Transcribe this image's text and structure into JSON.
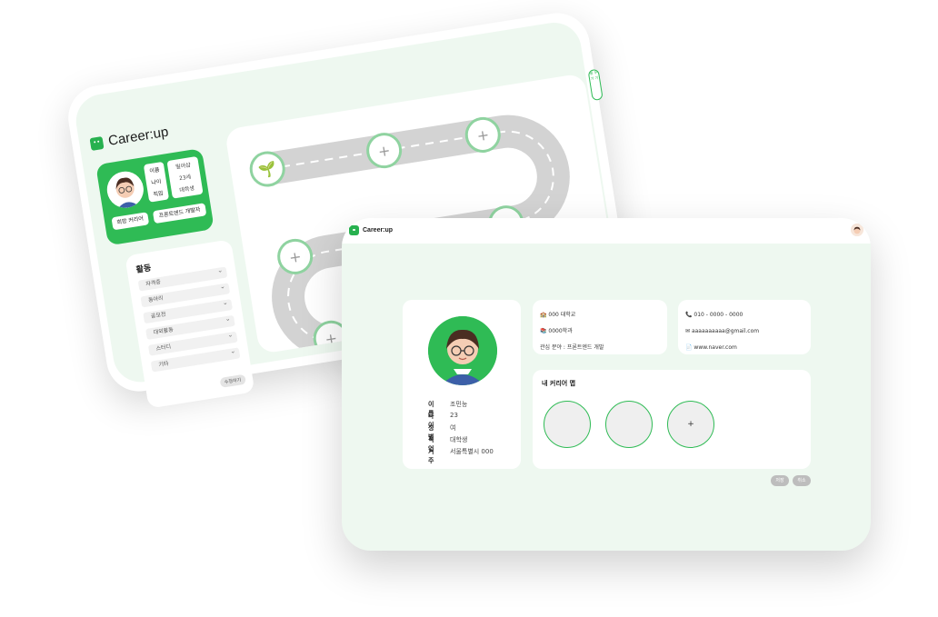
{
  "brand": {
    "name": "Career:up",
    "accent": "#2fbb55",
    "background": "#eef8f0"
  },
  "back_screen": {
    "profile": {
      "labels": [
        "이름",
        "나이",
        "직업"
      ],
      "values": [
        "밀아샵",
        "23세",
        "대학생"
      ],
      "dream_career_button": "희망 커리어",
      "career_value_button": "프론트엔드 개발자"
    },
    "activities": {
      "title": "활동",
      "items": [
        "자격증",
        "동아리",
        "공모전",
        "대외활동",
        "스터디",
        "기타"
      ],
      "edit_button": "수정하기"
    },
    "road": {
      "start_icon": "sprout-icon",
      "add_node_icon": "plus-icon"
    },
    "side_tab": "밑 두 가 기"
  },
  "front_screen": {
    "profile": {
      "fields": [
        {
          "label": "이름",
          "value": "조민능"
        },
        {
          "label": "나이",
          "value": "23"
        },
        {
          "label": "성별",
          "value": "여"
        },
        {
          "label": "직업",
          "value": "대학생"
        },
        {
          "label": "거주",
          "value": "서울특별시 000"
        }
      ]
    },
    "school": {
      "university": "000 대학교",
      "department": "0000학과",
      "interest": "관심 분야 : 프론트엔드 개발"
    },
    "contact": {
      "phone": "010 - 0000 - 0000",
      "email": "aaaaaaaaaa@gmail.com",
      "website": "www.naver.com"
    },
    "career_map": {
      "title": "내 커리어 맵",
      "add_symbol": "+"
    },
    "buttons": {
      "confirm": "저장",
      "cancel": "취소"
    }
  }
}
